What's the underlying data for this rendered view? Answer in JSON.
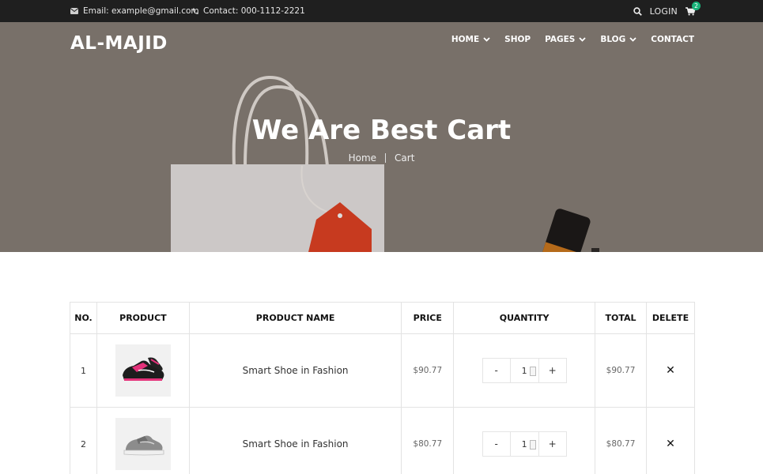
{
  "topbar": {
    "email": "Email: example@gmail.com",
    "phone": "Contact: 000-1112-2221",
    "login": "LOGIN",
    "cart_count": "2"
  },
  "header": {
    "logo": "AL-MAJID",
    "nav": [
      {
        "label": "HOME",
        "has_dropdown": true
      },
      {
        "label": "SHOP",
        "has_dropdown": false
      },
      {
        "label": "PAGES",
        "has_dropdown": true
      },
      {
        "label": "BLOG",
        "has_dropdown": true
      },
      {
        "label": "CONTACT",
        "has_dropdown": false
      }
    ]
  },
  "hero": {
    "title": "We Are Best Cart",
    "breadcrumb": [
      "Home",
      "Cart"
    ]
  },
  "table": {
    "headers": [
      "NO.",
      "PRODUCT",
      "PRODUCT NAME",
      "PRICE",
      "QUANTITY",
      "TOTAL",
      "DELETE"
    ],
    "rows": [
      {
        "no": "1",
        "image": "pink-black-sneaker",
        "name": "Smart Shoe in Fashion",
        "price": "$90.77",
        "minus": "-",
        "qty": "1",
        "plus": "+",
        "total": "$90.77",
        "delete": "✕"
      },
      {
        "no": "2",
        "image": "grey-white-sneaker",
        "name": "Smart Shoe in Fashion",
        "price": "$80.77",
        "minus": "-",
        "qty": "1",
        "plus": "+",
        "total": "$80.77",
        "delete": "✕"
      }
    ]
  },
  "colors": {
    "topbar_bg": "#1f1f1f",
    "badge": "#19b37a",
    "hero_overlay": "#7b716a"
  }
}
